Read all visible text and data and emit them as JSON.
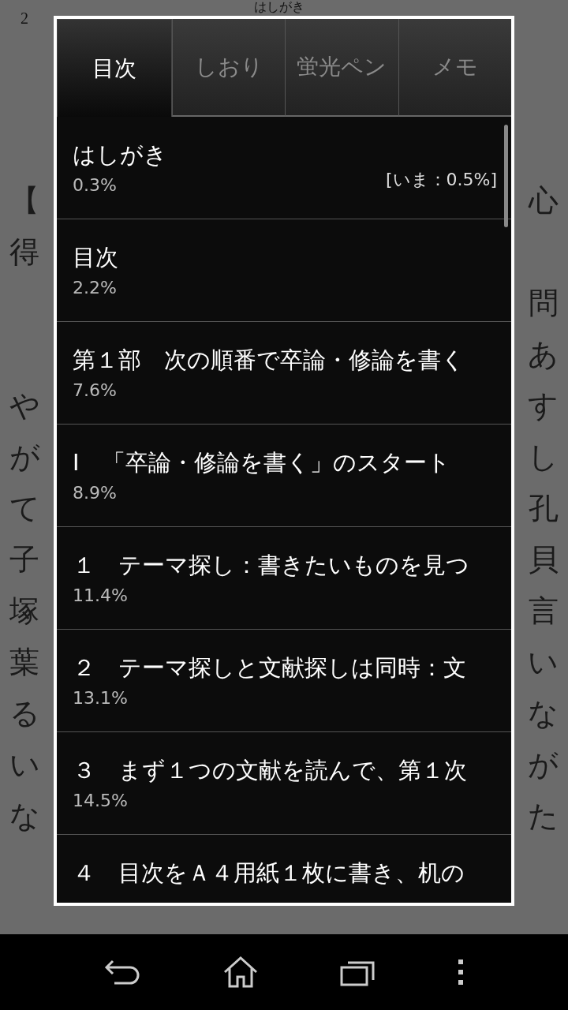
{
  "page": {
    "page_number": "2",
    "running_head": "はしがき",
    "lines": [
      {
        "left": "【",
        "right": "心"
      },
      {
        "left": "得"
      },
      {
        "right": "問"
      },
      {
        "right": "あ"
      },
      {
        "left": "や",
        "right": "す"
      },
      {
        "left": "が",
        "right": "し"
      },
      {
        "left": "て",
        "right": "孔"
      },
      {
        "left": "子",
        "right": "貝"
      },
      {
        "left": "塚",
        "right": "言"
      },
      {
        "left": "葉",
        "right": "い"
      },
      {
        "left": "る",
        "right": "な"
      },
      {
        "left": "い",
        "right": "が"
      },
      {
        "left": "な",
        "right": "た"
      }
    ]
  },
  "tabs": [
    {
      "label": "目次",
      "selected": true
    },
    {
      "label": "しおり",
      "selected": false
    },
    {
      "label": "蛍光ペン",
      "selected": false
    },
    {
      "label": "メモ",
      "selected": false
    }
  ],
  "toc": [
    {
      "title": "はしがき",
      "percent": "0.3%",
      "current": "[いま：0.5%]"
    },
    {
      "title": "目次",
      "percent": "2.2%"
    },
    {
      "title": "第１部　次の順番で卒論・修論を書く",
      "percent": "7.6%"
    },
    {
      "title": "Ⅰ　「卒論・修論を書く」のスタート",
      "percent": "8.9%"
    },
    {
      "title": "１　テーマ探し：書きたいものを見つ",
      "percent": "11.4%"
    },
    {
      "title": "２　テーマ探しと文献探しは同時：文",
      "percent": "13.1%"
    },
    {
      "title": "３　まず１つの文献を読んで、第１次",
      "percent": "14.5%"
    },
    {
      "title": "４　目次をＡ４用紙１枚に書き、机の"
    }
  ]
}
